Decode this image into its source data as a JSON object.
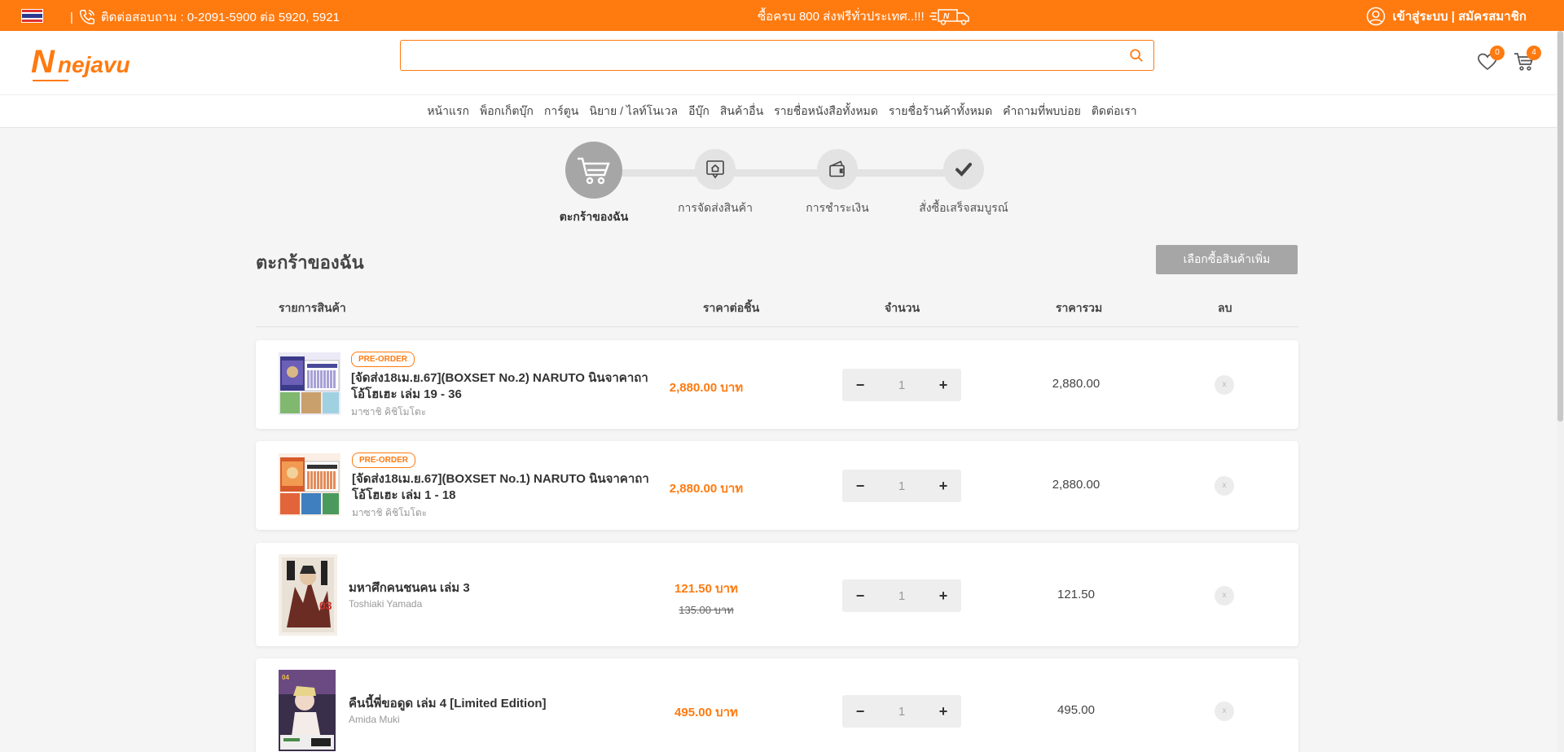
{
  "topbar": {
    "contact_label": "ติดต่อสอบถาม : 0-2091-5900 ต่อ 5920, 5921",
    "promo": "ซื้อครบ 800 ส่งฟรีทั่วประเทศ..!!!",
    "account": "เข้าสู่ระบบ | สมัครสมาชิก"
  },
  "header": {
    "logo_letter": "N",
    "logo_text": "nejavu",
    "search_placeholder": "",
    "wishlist_count": "0",
    "cart_count": "4"
  },
  "nav": [
    "หน้าแรก",
    "พ็อกเก็ตบุ๊ก",
    "การ์ตูน",
    "นิยาย / ไลท์โนเวล",
    "อีบุ๊ก",
    "สินค้าอื่น",
    "รายชื่อหนังสือทั้งหมด",
    "รายชื่อร้านค้าทั้งหมด",
    "คำถามที่พบบ่อย",
    "ติดต่อเรา"
  ],
  "steps": [
    {
      "label": "ตะกร้าของฉัน",
      "icon": "cart-icon",
      "active": true
    },
    {
      "label": "การจัดส่งสินค้า",
      "icon": "delivery-icon",
      "active": false
    },
    {
      "label": "การชำระเงิน",
      "icon": "wallet-icon",
      "active": false
    },
    {
      "label": "สั่งซื้อเสร็จสมบูรณ์",
      "icon": "check-icon",
      "active": false
    }
  ],
  "cart": {
    "title": "ตะกร้าของฉัน",
    "more_button": "เลือกซื้อสินค้าเพิ่ม",
    "columns": {
      "item": "รายการสินค้า",
      "unit_price": "ราคาต่อชิ้น",
      "quantity": "จำนวน",
      "total": "ราคารวม",
      "delete": "ลบ"
    },
    "items": [
      {
        "tag": "PRE-ORDER",
        "title_line1": "[จัดส่ง18เม.ย.67](BOXSET No.2) NARUTO นินจาคาถา",
        "title_line2": "โอ้โฮเฮะ เล่ม 19 - 36",
        "author": "มาซาชิ คิชิโมโตะ",
        "price": "2,880.00 บาท",
        "old_price": "",
        "qty": "1",
        "total": "2,880.00",
        "del": "x"
      },
      {
        "tag": "PRE-ORDER",
        "title_line1": "[จัดส่ง18เม.ย.67](BOXSET No.1) NARUTO นินจาคาถา",
        "title_line2": "โอ้โฮเฮะ เล่ม 1 - 18",
        "author": "มาซาชิ คิชิโมโตะ",
        "price": "2,880.00 บาท",
        "old_price": "",
        "qty": "1",
        "total": "2,880.00",
        "del": "x"
      },
      {
        "tag": "",
        "title_line1": "มหาศึกคนชนคน เล่ม 3",
        "title_line2": "",
        "author": "Toshiaki Yamada",
        "price": "121.50 บาท",
        "old_price": "135.00 บาท",
        "qty": "1",
        "total": "121.50",
        "del": "x"
      },
      {
        "tag": "",
        "title_line1": "คืนนี้พี่ขอดูด เล่ม 4 [Limited Edition]",
        "title_line2": "",
        "author": "Amida Muki",
        "price": "495.00 บาท",
        "old_price": "",
        "qty": "1",
        "total": "495.00",
        "del": "x"
      }
    ],
    "minus": "−",
    "plus": "+"
  },
  "colors": {
    "brand": "#ff7a0f",
    "step_active": "#a6a6a6",
    "step_inactive": "#e3e3e3"
  }
}
